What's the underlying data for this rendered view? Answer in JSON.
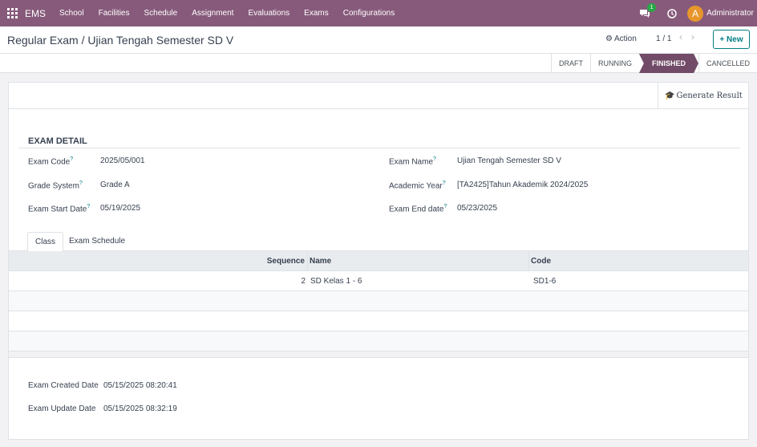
{
  "navbar": {
    "brand": "EMS",
    "menu": [
      "School",
      "Facilities",
      "Schedule",
      "Assignment",
      "Evaluations",
      "Exams",
      "Configurations"
    ],
    "chat_badge": "1",
    "avatar_letter": "A",
    "user_name": "Administrator"
  },
  "control": {
    "breadcrumb": "Regular Exam / Ujian Tengah Semester SD V",
    "action_label": "Action",
    "pager": "1 / 1",
    "new_label": "New"
  },
  "stages": [
    "DRAFT",
    "RUNNING",
    "FINISHED",
    "CANCELLED"
  ],
  "active_stage": "FINISHED",
  "buttons": {
    "generate_result": "Generate Result"
  },
  "form": {
    "section_title": "EXAM DETAIL",
    "exam_code_label": "Exam Code",
    "exam_code": "2025/05/001",
    "exam_name_label": "Exam Name",
    "exam_name": "Ujian Tengah Semester SD V",
    "grade_system_label": "Grade System",
    "grade_system": "Grade A",
    "academic_year_label": "Academic Year",
    "academic_year": "[TA2425]Tahun Akademik 2024/2025",
    "start_date_label": "Exam Start Date",
    "start_date": "05/19/2025",
    "end_date_label": "Exam End date",
    "end_date": "05/23/2025",
    "help_mark": "?"
  },
  "tabs": [
    "Class",
    "Exam Schedule"
  ],
  "table": {
    "headers": {
      "sequence": "Sequence",
      "name": "Name",
      "code": "Code"
    },
    "rows": [
      {
        "sequence": "2",
        "name": "SD Kelas 1 - 6",
        "code": "SD1-6"
      }
    ]
  },
  "footer": {
    "created_label": "Exam Created Date",
    "created": "05/15/2025 08:20:41",
    "updated_label": "Exam Update Date",
    "updated": "05/15/2025 08:32:19"
  },
  "colors": {
    "navbar": "#875a7b",
    "active_stage": "#714b67",
    "primary": "#017e84",
    "avatar": "#e8962c",
    "badge": "#28a745"
  }
}
